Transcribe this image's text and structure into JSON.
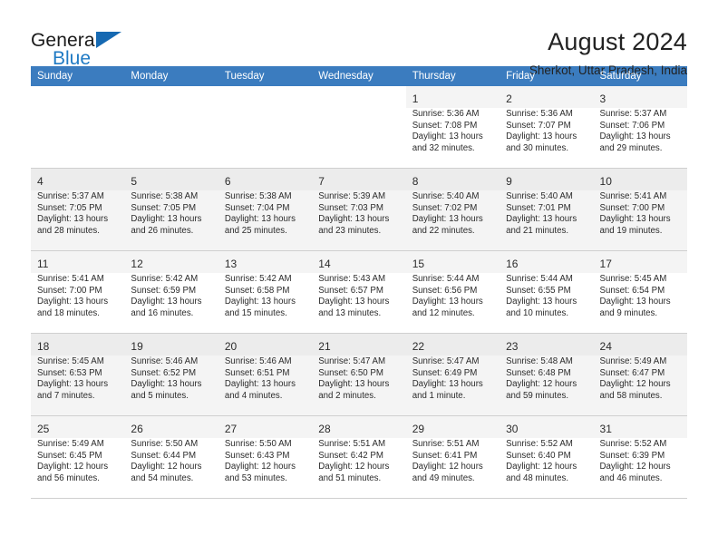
{
  "brand": {
    "name_top": "General",
    "name_bottom": "Blue",
    "flag_icon": "blue-triangle-flag-icon"
  },
  "header": {
    "title": "August 2024",
    "location": "Sherkot, Uttar Pradesh, India"
  },
  "calendar": {
    "weekday_headers": [
      "Sunday",
      "Monday",
      "Tuesday",
      "Wednesday",
      "Thursday",
      "Friday",
      "Saturday"
    ],
    "accent_color": "#3b7cbf",
    "weeks": [
      [
        {
          "day": "",
          "sunrise": "",
          "sunset": "",
          "daylight1": "",
          "daylight2": ""
        },
        {
          "day": "",
          "sunrise": "",
          "sunset": "",
          "daylight1": "",
          "daylight2": ""
        },
        {
          "day": "",
          "sunrise": "",
          "sunset": "",
          "daylight1": "",
          "daylight2": ""
        },
        {
          "day": "",
          "sunrise": "",
          "sunset": "",
          "daylight1": "",
          "daylight2": ""
        },
        {
          "day": "1",
          "sunrise": "Sunrise: 5:36 AM",
          "sunset": "Sunset: 7:08 PM",
          "daylight1": "Daylight: 13 hours",
          "daylight2": "and 32 minutes."
        },
        {
          "day": "2",
          "sunrise": "Sunrise: 5:36 AM",
          "sunset": "Sunset: 7:07 PM",
          "daylight1": "Daylight: 13 hours",
          "daylight2": "and 30 minutes."
        },
        {
          "day": "3",
          "sunrise": "Sunrise: 5:37 AM",
          "sunset": "Sunset: 7:06 PM",
          "daylight1": "Daylight: 13 hours",
          "daylight2": "and 29 minutes."
        }
      ],
      [
        {
          "day": "4",
          "sunrise": "Sunrise: 5:37 AM",
          "sunset": "Sunset: 7:05 PM",
          "daylight1": "Daylight: 13 hours",
          "daylight2": "and 28 minutes."
        },
        {
          "day": "5",
          "sunrise": "Sunrise: 5:38 AM",
          "sunset": "Sunset: 7:05 PM",
          "daylight1": "Daylight: 13 hours",
          "daylight2": "and 26 minutes."
        },
        {
          "day": "6",
          "sunrise": "Sunrise: 5:38 AM",
          "sunset": "Sunset: 7:04 PM",
          "daylight1": "Daylight: 13 hours",
          "daylight2": "and 25 minutes."
        },
        {
          "day": "7",
          "sunrise": "Sunrise: 5:39 AM",
          "sunset": "Sunset: 7:03 PM",
          "daylight1": "Daylight: 13 hours",
          "daylight2": "and 23 minutes."
        },
        {
          "day": "8",
          "sunrise": "Sunrise: 5:40 AM",
          "sunset": "Sunset: 7:02 PM",
          "daylight1": "Daylight: 13 hours",
          "daylight2": "and 22 minutes."
        },
        {
          "day": "9",
          "sunrise": "Sunrise: 5:40 AM",
          "sunset": "Sunset: 7:01 PM",
          "daylight1": "Daylight: 13 hours",
          "daylight2": "and 21 minutes."
        },
        {
          "day": "10",
          "sunrise": "Sunrise: 5:41 AM",
          "sunset": "Sunset: 7:00 PM",
          "daylight1": "Daylight: 13 hours",
          "daylight2": "and 19 minutes."
        }
      ],
      [
        {
          "day": "11",
          "sunrise": "Sunrise: 5:41 AM",
          "sunset": "Sunset: 7:00 PM",
          "daylight1": "Daylight: 13 hours",
          "daylight2": "and 18 minutes."
        },
        {
          "day": "12",
          "sunrise": "Sunrise: 5:42 AM",
          "sunset": "Sunset: 6:59 PM",
          "daylight1": "Daylight: 13 hours",
          "daylight2": "and 16 minutes."
        },
        {
          "day": "13",
          "sunrise": "Sunrise: 5:42 AM",
          "sunset": "Sunset: 6:58 PM",
          "daylight1": "Daylight: 13 hours",
          "daylight2": "and 15 minutes."
        },
        {
          "day": "14",
          "sunrise": "Sunrise: 5:43 AM",
          "sunset": "Sunset: 6:57 PM",
          "daylight1": "Daylight: 13 hours",
          "daylight2": "and 13 minutes."
        },
        {
          "day": "15",
          "sunrise": "Sunrise: 5:44 AM",
          "sunset": "Sunset: 6:56 PM",
          "daylight1": "Daylight: 13 hours",
          "daylight2": "and 12 minutes."
        },
        {
          "day": "16",
          "sunrise": "Sunrise: 5:44 AM",
          "sunset": "Sunset: 6:55 PM",
          "daylight1": "Daylight: 13 hours",
          "daylight2": "and 10 minutes."
        },
        {
          "day": "17",
          "sunrise": "Sunrise: 5:45 AM",
          "sunset": "Sunset: 6:54 PM",
          "daylight1": "Daylight: 13 hours",
          "daylight2": "and 9 minutes."
        }
      ],
      [
        {
          "day": "18",
          "sunrise": "Sunrise: 5:45 AM",
          "sunset": "Sunset: 6:53 PM",
          "daylight1": "Daylight: 13 hours",
          "daylight2": "and 7 minutes."
        },
        {
          "day": "19",
          "sunrise": "Sunrise: 5:46 AM",
          "sunset": "Sunset: 6:52 PM",
          "daylight1": "Daylight: 13 hours",
          "daylight2": "and 5 minutes."
        },
        {
          "day": "20",
          "sunrise": "Sunrise: 5:46 AM",
          "sunset": "Sunset: 6:51 PM",
          "daylight1": "Daylight: 13 hours",
          "daylight2": "and 4 minutes."
        },
        {
          "day": "21",
          "sunrise": "Sunrise: 5:47 AM",
          "sunset": "Sunset: 6:50 PM",
          "daylight1": "Daylight: 13 hours",
          "daylight2": "and 2 minutes."
        },
        {
          "day": "22",
          "sunrise": "Sunrise: 5:47 AM",
          "sunset": "Sunset: 6:49 PM",
          "daylight1": "Daylight: 13 hours",
          "daylight2": "and 1 minute."
        },
        {
          "day": "23",
          "sunrise": "Sunrise: 5:48 AM",
          "sunset": "Sunset: 6:48 PM",
          "daylight1": "Daylight: 12 hours",
          "daylight2": "and 59 minutes."
        },
        {
          "day": "24",
          "sunrise": "Sunrise: 5:49 AM",
          "sunset": "Sunset: 6:47 PM",
          "daylight1": "Daylight: 12 hours",
          "daylight2": "and 58 minutes."
        }
      ],
      [
        {
          "day": "25",
          "sunrise": "Sunrise: 5:49 AM",
          "sunset": "Sunset: 6:45 PM",
          "daylight1": "Daylight: 12 hours",
          "daylight2": "and 56 minutes."
        },
        {
          "day": "26",
          "sunrise": "Sunrise: 5:50 AM",
          "sunset": "Sunset: 6:44 PM",
          "daylight1": "Daylight: 12 hours",
          "daylight2": "and 54 minutes."
        },
        {
          "day": "27",
          "sunrise": "Sunrise: 5:50 AM",
          "sunset": "Sunset: 6:43 PM",
          "daylight1": "Daylight: 12 hours",
          "daylight2": "and 53 minutes."
        },
        {
          "day": "28",
          "sunrise": "Sunrise: 5:51 AM",
          "sunset": "Sunset: 6:42 PM",
          "daylight1": "Daylight: 12 hours",
          "daylight2": "and 51 minutes."
        },
        {
          "day": "29",
          "sunrise": "Sunrise: 5:51 AM",
          "sunset": "Sunset: 6:41 PM",
          "daylight1": "Daylight: 12 hours",
          "daylight2": "and 49 minutes."
        },
        {
          "day": "30",
          "sunrise": "Sunrise: 5:52 AM",
          "sunset": "Sunset: 6:40 PM",
          "daylight1": "Daylight: 12 hours",
          "daylight2": "and 48 minutes."
        },
        {
          "day": "31",
          "sunrise": "Sunrise: 5:52 AM",
          "sunset": "Sunset: 6:39 PM",
          "daylight1": "Daylight: 12 hours",
          "daylight2": "and 46 minutes."
        }
      ]
    ]
  }
}
